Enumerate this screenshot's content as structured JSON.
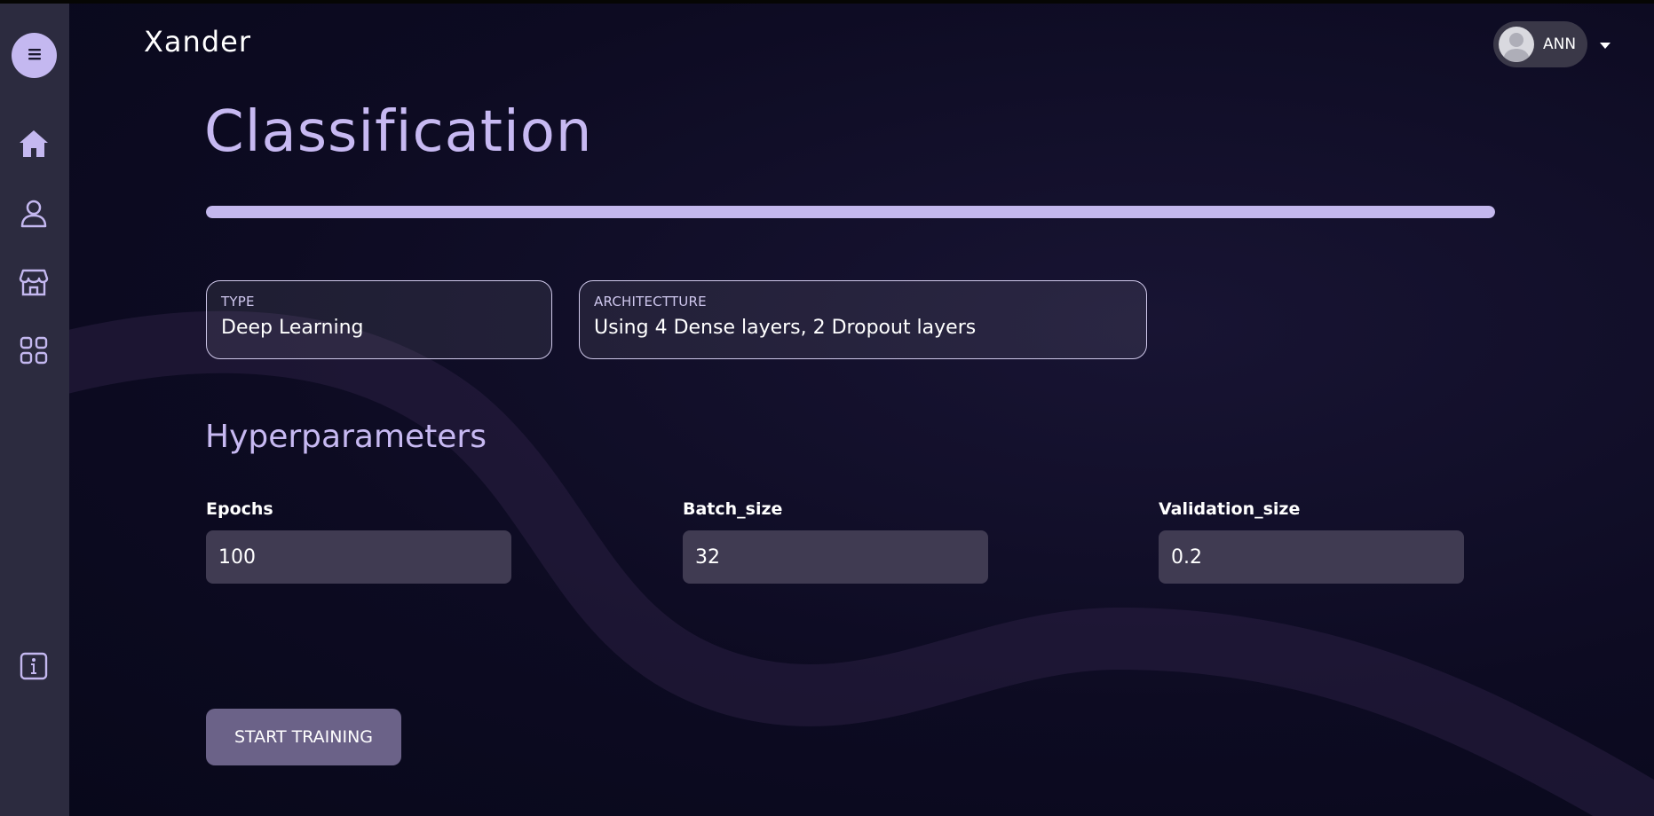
{
  "brand": "Xander",
  "user": {
    "name": "ANN"
  },
  "page": {
    "title": "Classification",
    "progress": 1.0
  },
  "model": {
    "type_label": "TYPE",
    "type_value": "Deep Learning",
    "arch_label": "ARCHITECTTURE",
    "arch_value": "Using 4 Dense layers, 2 Dropout layers"
  },
  "hyperparameters": {
    "title": "Hyperparameters",
    "epochs_label": "Epochs",
    "epochs_value": "100",
    "batch_label": "Batch_size",
    "batch_value": "32",
    "validation_label": "Validation_size",
    "validation_value": "0.2"
  },
  "actions": {
    "start_label": "START TRAINING"
  },
  "sidebar": {
    "icons": [
      "menu-icon",
      "home-icon",
      "user-icon",
      "store-icon",
      "grid-icon",
      "info-icon"
    ]
  },
  "colors": {
    "accent": "#c4b8f0",
    "sidebar": "#2c2b3f",
    "background": "#0d0b22",
    "input": "#403b52",
    "button": "#6b6288"
  }
}
